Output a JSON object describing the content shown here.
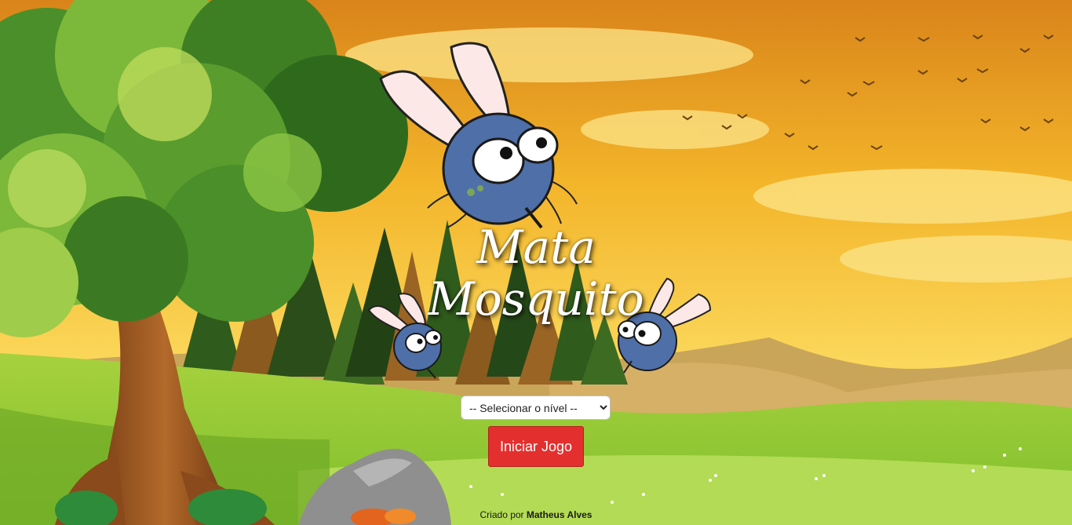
{
  "game": {
    "title_line1": "Mata",
    "title_line2": "Mosquito"
  },
  "level_select": {
    "selected": "-- Selecionar o nível --"
  },
  "start_button": {
    "label": "Iniciar Jogo"
  },
  "footer": {
    "prefix": "Criado por",
    "author": "Matheus Alves"
  },
  "colors": {
    "sky_top": "#e69a20",
    "sky_bottom": "#fbd85c",
    "grass": "#9ccf3a",
    "start_button": "#e3302f",
    "mosquito_body": "#4f6fa8"
  }
}
